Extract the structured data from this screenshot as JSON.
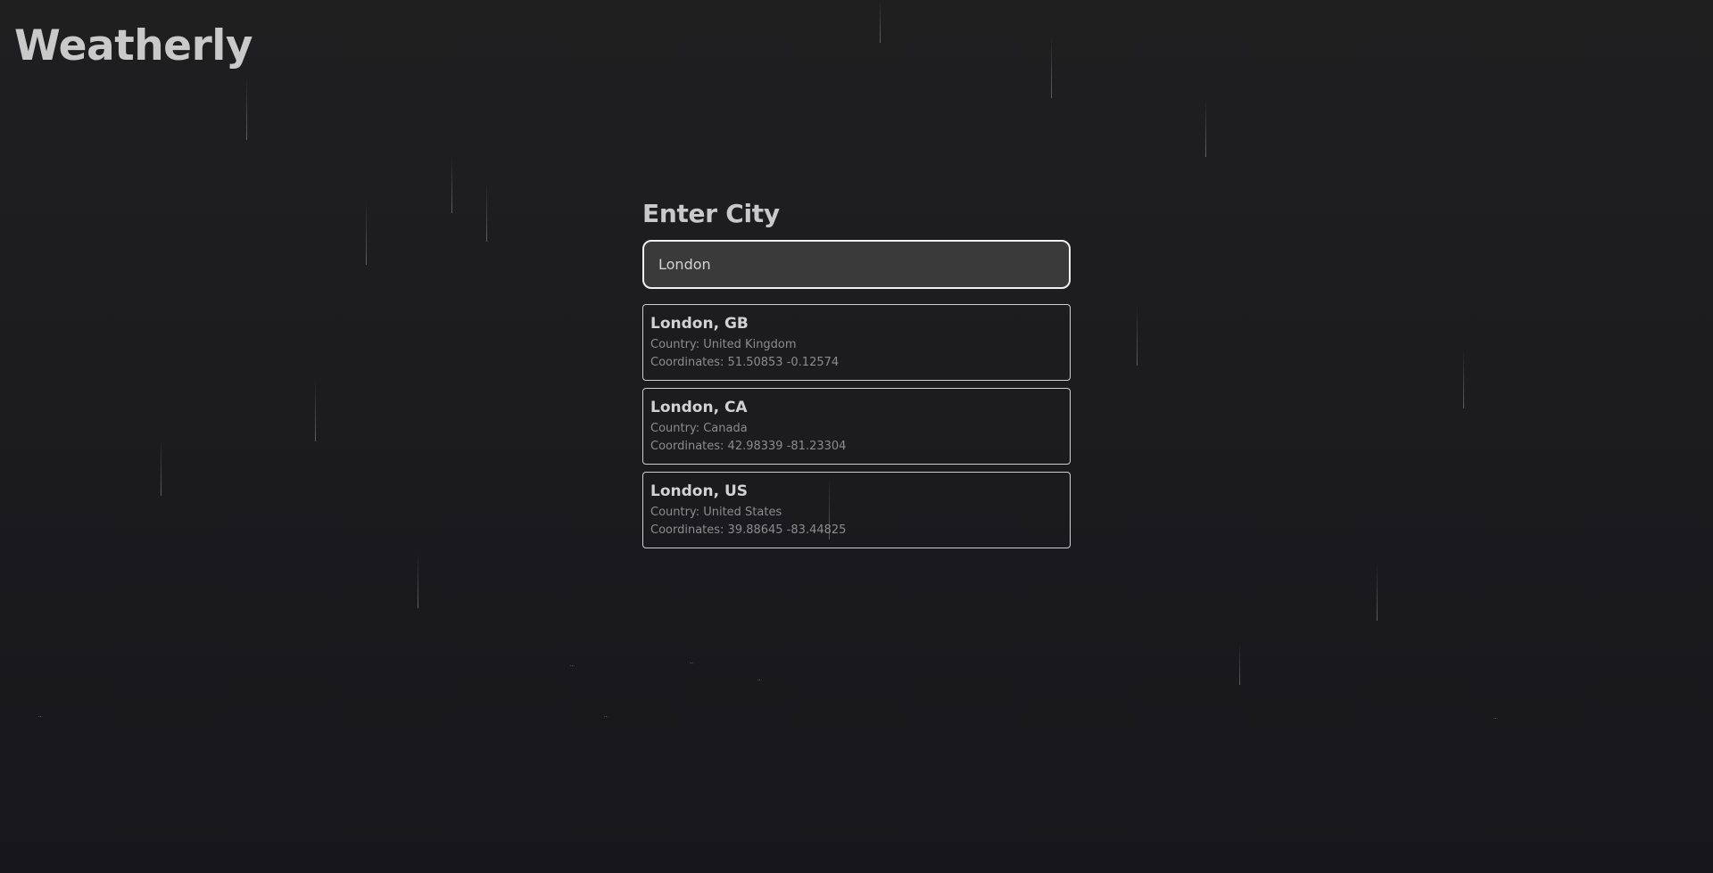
{
  "app": {
    "title": "Weatherly"
  },
  "search": {
    "heading": "Enter City",
    "value": "London",
    "placeholder": ""
  },
  "results": [
    {
      "name": "London, GB",
      "country": "Country: United Kingdom",
      "coordinates": "Coordinates: 51.50853 -0.12574"
    },
    {
      "name": "London, CA",
      "country": "Country: Canada",
      "coordinates": "Coordinates: 42.98339 -81.23304"
    },
    {
      "name": "London, US",
      "country": "Country: United States",
      "coordinates": "Coordinates: 39.88645 -83.44825"
    }
  ],
  "theme": {
    "background": "#1e1e20",
    "input_background": "#3a3a3a",
    "input_border": "#f1f1f1",
    "card_border": "#cfcfcf",
    "text_primary": "#c9c9c9",
    "text_muted": "#8c8c8c"
  }
}
